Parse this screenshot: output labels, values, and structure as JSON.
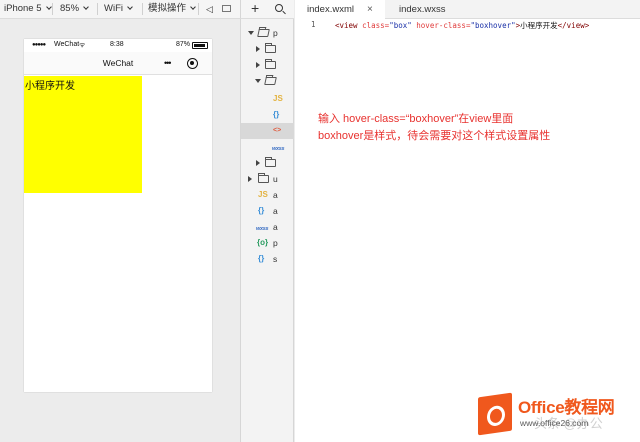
{
  "toolbar": {
    "device": "iPhone 5",
    "zoom": "85%",
    "network": "WiFi",
    "simulate": "模拟操作"
  },
  "phone": {
    "status": {
      "carrier": "WeChat",
      "time": "8:38",
      "battery": "87%"
    },
    "nav_title": "WeChat",
    "box_text": "小程序开发",
    "box_color": "#ffff00"
  },
  "tree": {
    "rows": [
      {
        "type": "folder",
        "state": "open",
        "label": "p"
      },
      {
        "type": "folder",
        "state": "closed",
        "label": ""
      },
      {
        "type": "folder",
        "state": "closed",
        "label": ""
      },
      {
        "type": "folder",
        "state": "open",
        "label": ""
      },
      {
        "type": "file",
        "icon": "JS",
        "label": ""
      },
      {
        "type": "file",
        "icon": "{}",
        "label": ""
      },
      {
        "type": "file",
        "icon": "<>",
        "label": ""
      },
      {
        "type": "file",
        "icon": "wxss",
        "label": ""
      },
      {
        "type": "folder",
        "state": "closed",
        "label": ""
      },
      {
        "type": "folder",
        "state": "closed",
        "label": "u"
      },
      {
        "type": "file",
        "icon": "JS",
        "label": "a"
      },
      {
        "type": "file",
        "icon": "{}",
        "label": "a"
      },
      {
        "type": "file",
        "icon": "wxss",
        "label": "a"
      },
      {
        "type": "file",
        "icon": "{o}",
        "label": "p"
      },
      {
        "type": "file",
        "icon": "{}",
        "label": "s"
      }
    ]
  },
  "editor": {
    "tabs": [
      {
        "label": "index.wxml",
        "close": "×"
      },
      {
        "label": "index.wxss"
      }
    ],
    "line_number": "1",
    "code": {
      "open_tag": "<view",
      "attr_class": " class=",
      "val_class": "\"box\"",
      "attr_hover": " hover-class=",
      "val_hover": "\"boxhover\"",
      "tag_close": ">",
      "text": "小程序开发",
      "end_tag": "</view>"
    },
    "annotation": [
      "输入 hover-class=“boxhover”在view里面",
      "boxhover是样式，待会需要对这个样式设置属性"
    ]
  },
  "watermark": {
    "title": "Office教程网",
    "subtitle": "www.office26.com",
    "faint": "头条 @办公"
  },
  "colors": {
    "annotation": "#e8322f",
    "brand": "#f0581d"
  }
}
